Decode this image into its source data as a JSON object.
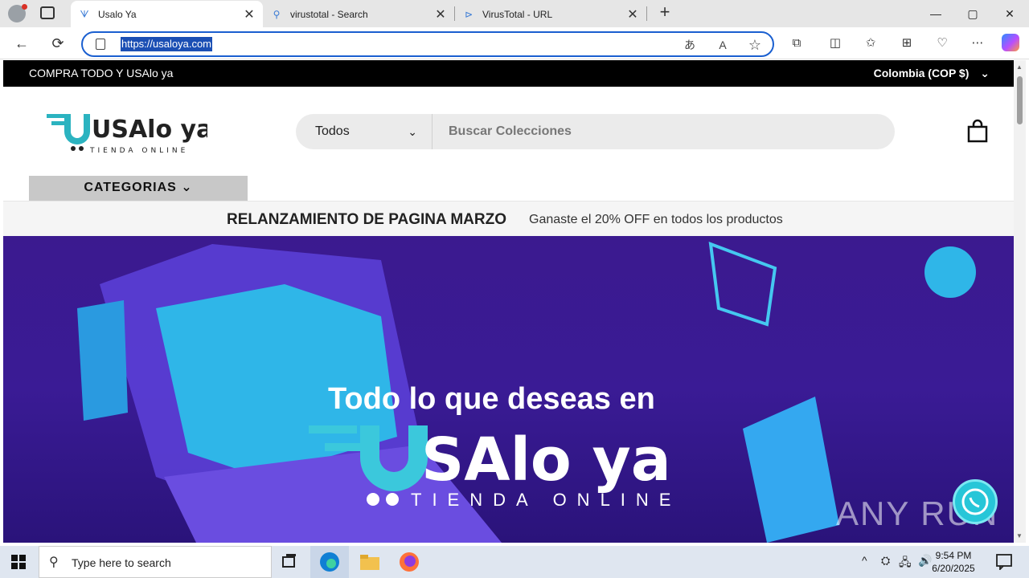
{
  "browser": {
    "tabs": [
      {
        "label": "Usalo Ya",
        "favicon": "usaloya-favicon",
        "active": true
      },
      {
        "label": "virustotal - Search",
        "favicon": "search-icon",
        "active": false
      },
      {
        "label": "VirusTotal - URL",
        "favicon": "virustotal-icon",
        "active": false
      }
    ],
    "url": "https://usaloya.com",
    "icons": {
      "back": "←",
      "refresh": "⟳",
      "translate": "あ",
      "read_aloud": "A",
      "favorite": "☆",
      "extensions": "⧉",
      "split": "◫",
      "favorites": "✩",
      "collections": "⊞",
      "performance": "♡",
      "more": "⋯",
      "minimize": "—",
      "maximize": "▢",
      "close": "✕",
      "new_tab": "+",
      "tab_close": "✕"
    }
  },
  "site": {
    "announcement": "COMPRA TODO Y USAlo ya",
    "currency": "Colombia (COP $)",
    "currency_chevron": "⌄",
    "logo_text": "USAlo ya",
    "logo_tagline": "TIENDA ONLINE",
    "search": {
      "category": "Todos",
      "placeholder": "Buscar Colecciones"
    },
    "categories_label": "CATEGORIAS ⌄",
    "promo_title": "RELANZAMIENTO DE PAGINA MARZO",
    "promo_sub": "Ganaste el 20% OFF en todos los productos",
    "hero": {
      "headline": "Todo lo que deseas en",
      "wordmark": "SAlo ya",
      "tagline": "TIENDA ONLINE"
    },
    "watermark": "ANY RUN"
  },
  "taskbar": {
    "search_placeholder": "Type here to search",
    "time": "9:54 PM",
    "date": "6/20/2025",
    "tray_chevron": "^"
  },
  "colors": {
    "accent": "#1a5fd0",
    "brand_teal": "#27c6d8",
    "hero_purple": "#3b1a8f"
  }
}
